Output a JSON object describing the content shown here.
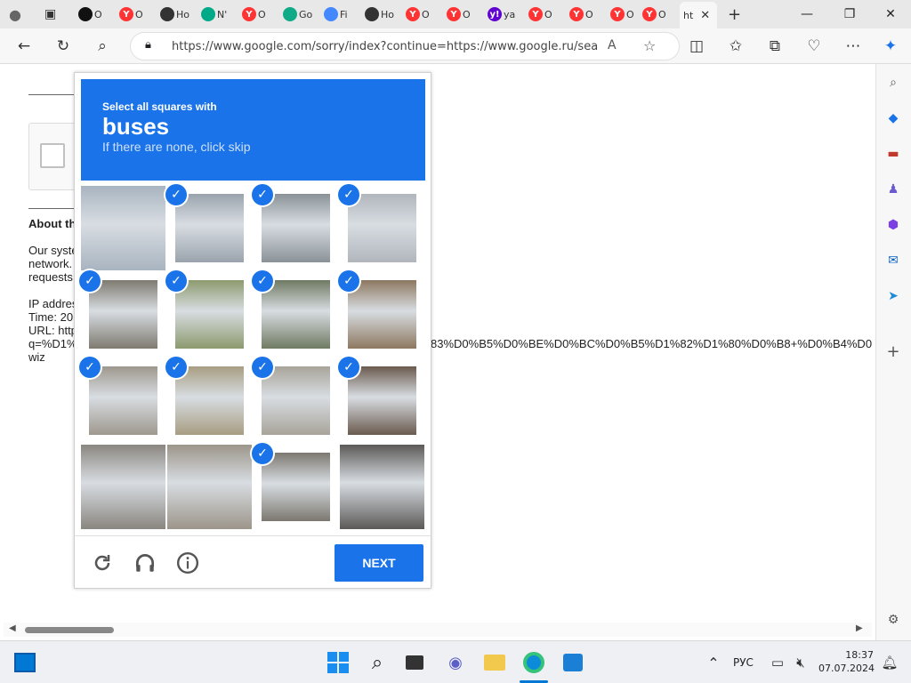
{
  "tabs": [
    {
      "label": "O",
      "icon": "plus-circle-icon",
      "color": "#111"
    },
    {
      "label": "O",
      "icon": "yandex-icon",
      "color": "#f33"
    },
    {
      "label": "Ho",
      "icon": "robot-icon",
      "color": "#333"
    },
    {
      "label": "N'",
      "icon": "msn-icon",
      "color": "#0a8"
    },
    {
      "label": "O",
      "icon": "yandex-icon",
      "color": "#f33"
    },
    {
      "label": "Go",
      "icon": "maps-icon",
      "color": "#1a8"
    },
    {
      "label": "Fi",
      "icon": "google-icon",
      "color": "#48f"
    },
    {
      "label": "Ho",
      "icon": "robot-icon",
      "color": "#333"
    },
    {
      "label": "O",
      "icon": "yandex-icon",
      "color": "#f33"
    },
    {
      "label": "O",
      "icon": "yandex-icon",
      "color": "#f33"
    },
    {
      "label": "ya",
      "icon": "yahoo-icon",
      "color": "#6001d2"
    },
    {
      "label": "O",
      "icon": "yandex-icon",
      "color": "#f33"
    },
    {
      "label": "O",
      "icon": "yandex-icon",
      "color": "#f33"
    },
    {
      "label": "O",
      "icon": "yandex-icon",
      "color": "#f33"
    },
    {
      "label": "O",
      "icon": "yandex-icon",
      "color": "#f33"
    }
  ],
  "active_tab": {
    "label": "ht"
  },
  "url": "https://www.google.com/sorry/index?continue=https://www.google.ru/sear...",
  "page": {
    "about_label": "About th",
    "line1": "Our syste",
    "line2": "network.",
    "line3": "requests",
    "line4": "IP addres",
    "line5": "Time: 20",
    "line6": "URL: http",
    "line7": "q=%D1%",
    "line7_tail": "83%D0%B5%D0%BE%D0%BC%D0%B5%D1%82%D1%80%D0%B8+%D0%B4%D0",
    "line8": "wiz"
  },
  "captcha": {
    "instruction": "Select all squares with",
    "target": "buses",
    "hint": "If there are none, click skip",
    "next_label": "NEXT",
    "tiles": [
      {
        "selected": false,
        "color": "#a8b4c0"
      },
      {
        "selected": true,
        "color": "#9aa3ad"
      },
      {
        "selected": true,
        "color": "#8a9298"
      },
      {
        "selected": true,
        "color": "#b0b6bc"
      },
      {
        "selected": true,
        "color": "#7e7a70"
      },
      {
        "selected": true,
        "color": "#8c9a6e"
      },
      {
        "selected": true,
        "color": "#6f7a62"
      },
      {
        "selected": true,
        "color": "#8d7860"
      },
      {
        "selected": true,
        "color": "#9e988e"
      },
      {
        "selected": true,
        "color": "#a79d82"
      },
      {
        "selected": true,
        "color": "#a8a49a"
      },
      {
        "selected": true,
        "color": "#6a5a4e"
      },
      {
        "selected": false,
        "color": "#8a8680"
      },
      {
        "selected": false,
        "color": "#9c958a"
      },
      {
        "selected": true,
        "color": "#7c7870"
      },
      {
        "selected": false,
        "color": "#5c5a58"
      }
    ]
  },
  "clock": {
    "time": "18:37",
    "date": "07.07.2024"
  },
  "lang": "РУС"
}
